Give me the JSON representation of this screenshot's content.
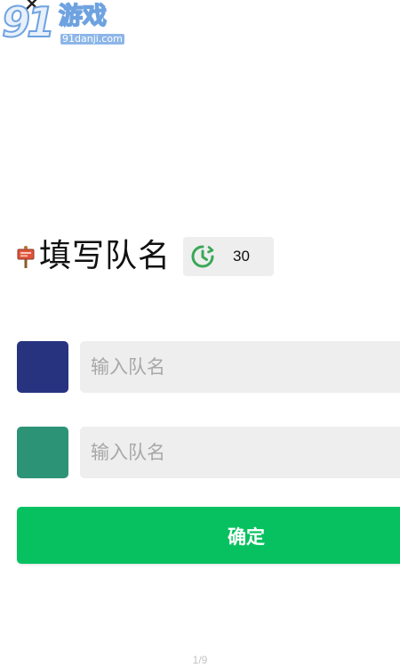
{
  "watermark": {
    "digits": "91",
    "brand_cn": "游戏",
    "url": "91danji.com"
  },
  "header": {
    "close_icon": "close-icon"
  },
  "title": {
    "text": "填写队名",
    "icon": "signpost-icon"
  },
  "timer": {
    "icon": "countdown-clock-icon",
    "value": "30",
    "icon_color": "#3aa857"
  },
  "teams": [
    {
      "swatch_color": "#283380",
      "placeholder": "输入队名",
      "value": ""
    },
    {
      "swatch_color": "#2d9377",
      "placeholder": "输入队名",
      "value": ""
    }
  ],
  "confirm": {
    "label": "确定",
    "color": "#07c160"
  },
  "pagination": {
    "text": "1/9"
  }
}
